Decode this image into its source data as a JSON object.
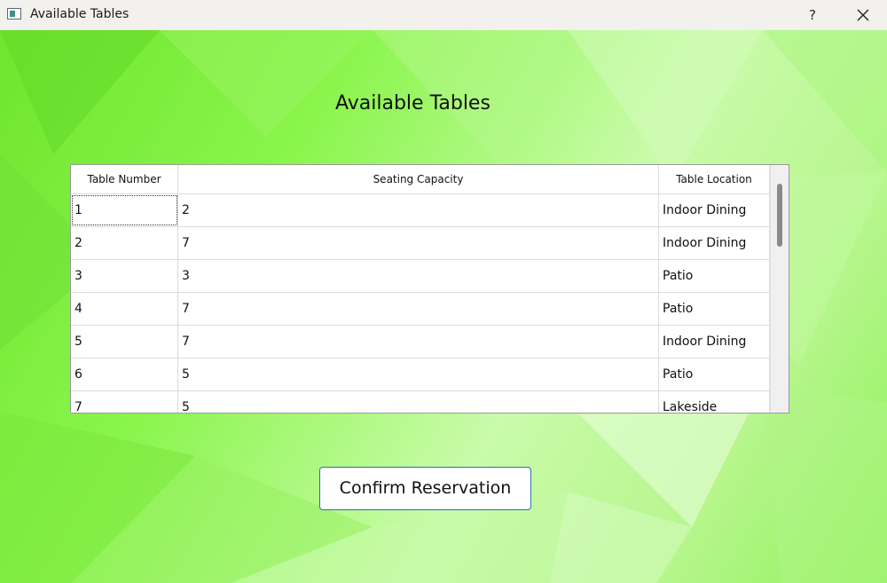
{
  "window": {
    "title": "Available Tables",
    "help_label": "?",
    "icons": {
      "app": "window-app-icon",
      "close": "close-icon"
    }
  },
  "main": {
    "heading": "Available Tables",
    "confirm_label": "Confirm Reservation"
  },
  "table": {
    "columns": [
      "Table Number",
      "Seating Capacity",
      "Table Location"
    ],
    "rows": [
      [
        "1",
        "2",
        "Indoor Dining"
      ],
      [
        "2",
        "7",
        "Indoor Dining"
      ],
      [
        "3",
        "3",
        "Patio"
      ],
      [
        "4",
        "7",
        "Patio"
      ],
      [
        "5",
        "7",
        "Indoor Dining"
      ],
      [
        "6",
        "5",
        "Patio"
      ],
      [
        "7",
        "5",
        "Lakeside"
      ]
    ]
  },
  "colors": {
    "background_green": "#7ee83d",
    "button_border": "#2a6fb0"
  }
}
